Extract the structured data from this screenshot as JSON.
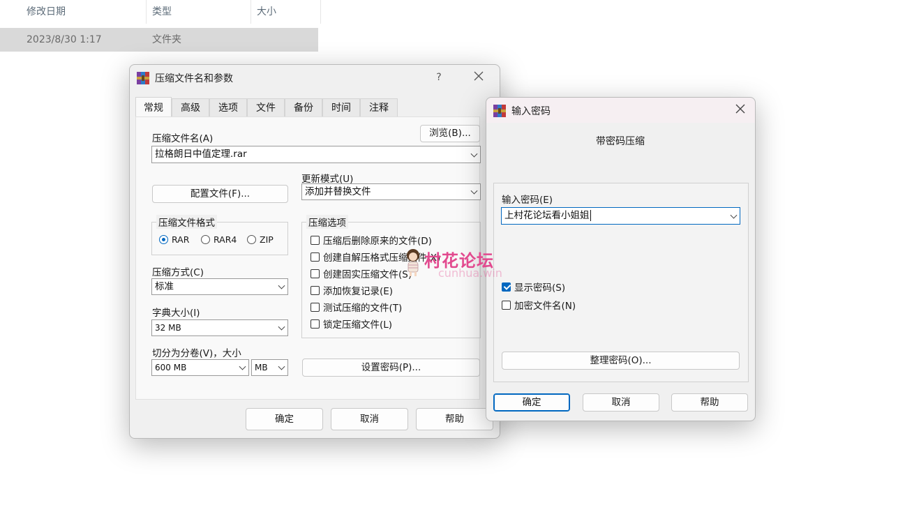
{
  "explorer": {
    "columns": [
      "修改日期",
      "类型",
      "大小"
    ],
    "row": {
      "date": "2023/8/30 1:17",
      "type": "文件夹"
    }
  },
  "archive_dialog": {
    "title": "压缩文件名和参数",
    "help_glyph": "?",
    "tabs": [
      "常规",
      "高级",
      "选项",
      "文件",
      "备份",
      "时间",
      "注释"
    ],
    "archive_name_label": "压缩文件名(A)",
    "browse_button": "浏览(B)...",
    "archive_name_value": "拉格朗日中值定理.rar",
    "update_mode_label": "更新模式(U)",
    "update_mode_value": "添加并替换文件",
    "profiles_button": "配置文件(F)...",
    "format_group": "压缩文件格式",
    "formats": [
      "RAR",
      "RAR4",
      "ZIP"
    ],
    "selected_format": "RAR",
    "options_group": "压缩选项",
    "options": [
      {
        "label": "压缩后删除原来的文件(D)",
        "checked": false
      },
      {
        "label": "创建自解压格式压缩文件(X)",
        "checked": false
      },
      {
        "label": "创建固实压缩文件(S)",
        "checked": false
      },
      {
        "label": "添加恢复记录(E)",
        "checked": false
      },
      {
        "label": "测试压缩的文件(T)",
        "checked": false
      },
      {
        "label": "锁定压缩文件(L)",
        "checked": false
      }
    ],
    "method_label": "压缩方式(C)",
    "method_value": "标准",
    "dict_label": "字典大小(I)",
    "dict_value": "32 MB",
    "split_label": "切分为分卷(V)，大小",
    "split_value": "600 MB",
    "split_unit": "MB",
    "set_password_button": "设置密码(P)...",
    "ok": "确定",
    "cancel": "取消",
    "help": "帮助"
  },
  "password_dialog": {
    "title": "输入密码",
    "heading": "带密码压缩",
    "password_label": "输入密码(E)",
    "password_value": "上村花论坛看小姐姐",
    "show_password": {
      "label": "显示密码(S)",
      "checked": true
    },
    "encrypt_names": {
      "label": "加密文件名(N)",
      "checked": false
    },
    "organize_button": "整理密码(O)...",
    "ok": "确定",
    "cancel": "取消",
    "help": "帮助"
  },
  "watermark": {
    "text": "村花论坛",
    "sub": "cunhua.win"
  },
  "colors": {
    "accent": "#0067c0",
    "watermark": "#e24a8f"
  }
}
